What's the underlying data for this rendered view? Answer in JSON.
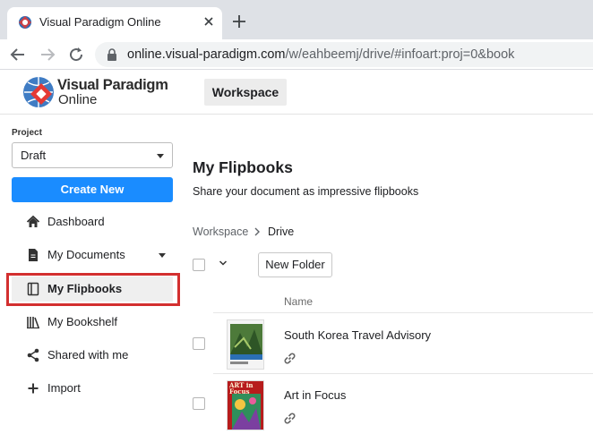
{
  "browser": {
    "tab_title": "Visual Paradigm Online",
    "url_host": "online.visual-paradigm.com",
    "url_path": "/w/eahbeemj/drive/#infoart:proj=0&book"
  },
  "header": {
    "logo_line1": "Visual Paradigm",
    "logo_line2": "Online",
    "workspace_label": "Workspace"
  },
  "sidebar": {
    "project_label": "Project",
    "project_value": "Draft",
    "create_label": "Create New",
    "items": [
      {
        "label": "Dashboard",
        "icon": "home-icon"
      },
      {
        "label": "My Documents",
        "icon": "document-icon"
      },
      {
        "label": "My Flipbooks",
        "icon": "flipbook-icon"
      },
      {
        "label": "My Bookshelf",
        "icon": "bookshelf-icon"
      },
      {
        "label": "Shared with me",
        "icon": "share-icon"
      },
      {
        "label": "Import",
        "icon": "plus-icon"
      }
    ],
    "active_item": "My Flipbooks"
  },
  "main": {
    "title": "My Flipbooks",
    "subtitle": "Share your document as impressive flipbooks",
    "breadcrumb": [
      "Workspace",
      "Drive"
    ],
    "new_folder_label": "New Folder",
    "column_name": "Name",
    "rows": [
      {
        "title": "South Korea Travel Advisory"
      },
      {
        "title": "Art in Focus",
        "thumb_text": "ART in Focus"
      }
    ]
  },
  "colors": {
    "accent": "#1a8cff",
    "highlight": "#d32f2f",
    "tabstrip": "#dee1e6"
  }
}
